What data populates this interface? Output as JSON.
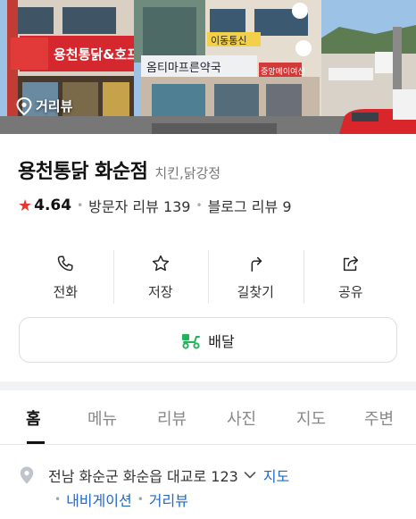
{
  "hero": {
    "roadview_label": "거리뷰",
    "sign_main": "용천통닭&호프",
    "sign_pharmacy": "옴티마프른약국",
    "sign_shop": "중앙메이여신",
    "sign_small": "이동통신"
  },
  "place": {
    "name": "용천통닭 화순점",
    "category": "치킨,닭강정",
    "rating": "4.64",
    "visitor_reviews": "방문자 리뷰 139",
    "blog_reviews": "블로그 리뷰 9"
  },
  "actions": {
    "call": "전화",
    "save": "저장",
    "directions": "길찾기",
    "share": "공유",
    "delivery": "배달"
  },
  "tabs": [
    "홈",
    "메뉴",
    "리뷰",
    "사진",
    "지도",
    "주변"
  ],
  "address": {
    "text": "전남 화순군 화순읍 대교로 123",
    "map_link": "지도",
    "navigation_link": "내비게이션",
    "roadview_link": "거리뷰"
  },
  "colors": {
    "star": "#e8372d",
    "link": "#1f67c9",
    "delivery_icon": "#21b45a"
  }
}
